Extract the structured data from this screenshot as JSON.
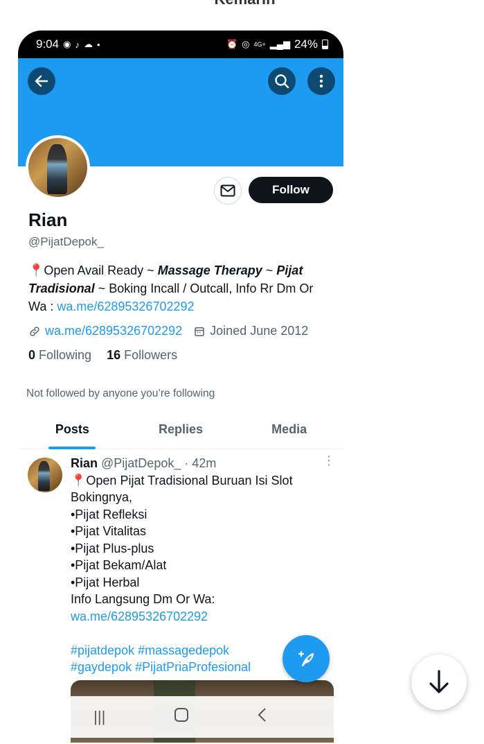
{
  "page_header": "Kemarin",
  "status_bar": {
    "time": "9:04",
    "network": "4G+",
    "battery": "24%"
  },
  "profile": {
    "name": "Rian",
    "handle": "@PijatDepok_",
    "bio_parts": {
      "pin": "📍",
      "p1": "Open Avail Ready ~ ",
      "b1": "Massage Therapy",
      "p2": " ~ ",
      "b2": "Pijat Tradisional",
      "p3": " ~ Boking Incall / Outcall, Info Rr Dm Or Wa : ",
      "link": "wa.me/62895326702292"
    },
    "website": "wa.me/62895326702292",
    "joined": "Joined June 2012",
    "following_count": "0",
    "following_label": "Following",
    "followers_count": "16",
    "followers_label": "Followers",
    "not_followed": "Not followed by anyone you’re following",
    "follow_label": "Follow"
  },
  "tabs": [
    "Posts",
    "Replies",
    "Media"
  ],
  "post": {
    "name": "Rian",
    "handle": "@PijatDepok_",
    "time": "· 42m",
    "lines": [
      "📍Open Pijat Tradisional Buruan Isi Slot",
      "Bokingnya,",
      "•Pijat Refleksi",
      "•Pijat Vitalitas",
      "•Pijat Plus-plus",
      "•Pijat Bekam/Alat",
      "•Pijat Herbal",
      "Info Langsung Dm Or Wa:"
    ],
    "link": "wa.me/62895326702292",
    "hashtags_1": "#pijatdepok #massagedepok",
    "hashtags_2": "#gaydepok #PijatPriaProfesional"
  },
  "colors": {
    "accent": "#1d9bf0",
    "text": "#0f1419",
    "secondary": "#536471"
  }
}
